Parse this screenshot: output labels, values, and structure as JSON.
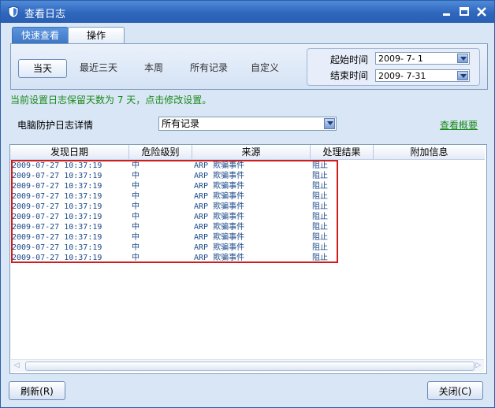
{
  "window": {
    "title": "查看日志"
  },
  "tabs": [
    {
      "label": "快速查看"
    },
    {
      "label": "操作"
    }
  ],
  "quick": [
    {
      "label": "当天"
    },
    {
      "label": "最近三天"
    },
    {
      "label": "本周"
    },
    {
      "label": "所有记录"
    },
    {
      "label": "自定义"
    }
  ],
  "dates": {
    "start_label": "起始时间",
    "start_value": "2009- 7- 1",
    "end_label": "结束时间",
    "end_value": "2009- 7-31"
  },
  "notice": "当前设置日志保留天数为 7 天，点击修改设置。",
  "filter": {
    "label": "电脑防护日志详情",
    "value": "所有记录",
    "link": "查看概要"
  },
  "columns": [
    "发现日期",
    "危险级别",
    "来源",
    "处理结果",
    "附加信息"
  ],
  "rows": [
    [
      "2009-07-27 10:37:19",
      "中",
      "ARP 欺骗事件",
      "阻止",
      ""
    ],
    [
      "2009-07-27 10:37:19",
      "中",
      "ARP 欺骗事件",
      "阻止",
      ""
    ],
    [
      "2009-07-27 10:37:19",
      "中",
      "ARP 欺骗事件",
      "阻止",
      ""
    ],
    [
      "2009-07-27 10:37:19",
      "中",
      "ARP 欺骗事件",
      "阻止",
      ""
    ],
    [
      "2009-07-27 10:37:19",
      "中",
      "ARP 欺骗事件",
      "阻止",
      ""
    ],
    [
      "2009-07-27 10:37:19",
      "中",
      "ARP 欺骗事件",
      "阻止",
      ""
    ],
    [
      "2009-07-27 10:37:19",
      "中",
      "ARP 欺骗事件",
      "阻止",
      ""
    ],
    [
      "2009-07-27 10:37:19",
      "中",
      "ARP 欺骗事件",
      "阻止",
      ""
    ],
    [
      "2009-07-27 10:37:19",
      "中",
      "ARP 欺骗事件",
      "阻止",
      ""
    ],
    [
      "2009-07-27 10:37:19",
      "中",
      "ARP 欺骗事件",
      "阻止",
      ""
    ]
  ],
  "buttons": {
    "refresh": "刷新(R)",
    "close": "关闭(C)"
  },
  "colors": {
    "titlebar": "#2f67bd",
    "highlight": "#d01c1c",
    "notice": "#1a8a1a"
  }
}
